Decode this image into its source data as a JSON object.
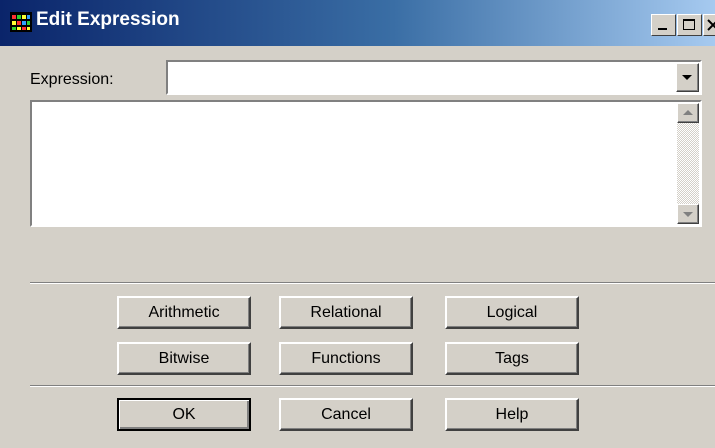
{
  "window": {
    "title": "Edit Expression",
    "controls": [
      "minimize-icon",
      "maximize-icon",
      "close-icon"
    ]
  },
  "expression": {
    "label": "Expression:",
    "combo_value": "",
    "text_value": ""
  },
  "operator_buttons": {
    "arithmetic": "Arithmetic",
    "relational": "Relational",
    "logical": "Logical",
    "bitwise": "Bitwise",
    "functions": "Functions",
    "tags": "Tags"
  },
  "dialog_buttons": {
    "ok": "OK",
    "cancel": "Cancel",
    "help": "Help"
  },
  "colors": {
    "titlebar_start": "#0a246a",
    "titlebar_end": "#a6caf0",
    "dialog_face": "#d4d0c8"
  }
}
